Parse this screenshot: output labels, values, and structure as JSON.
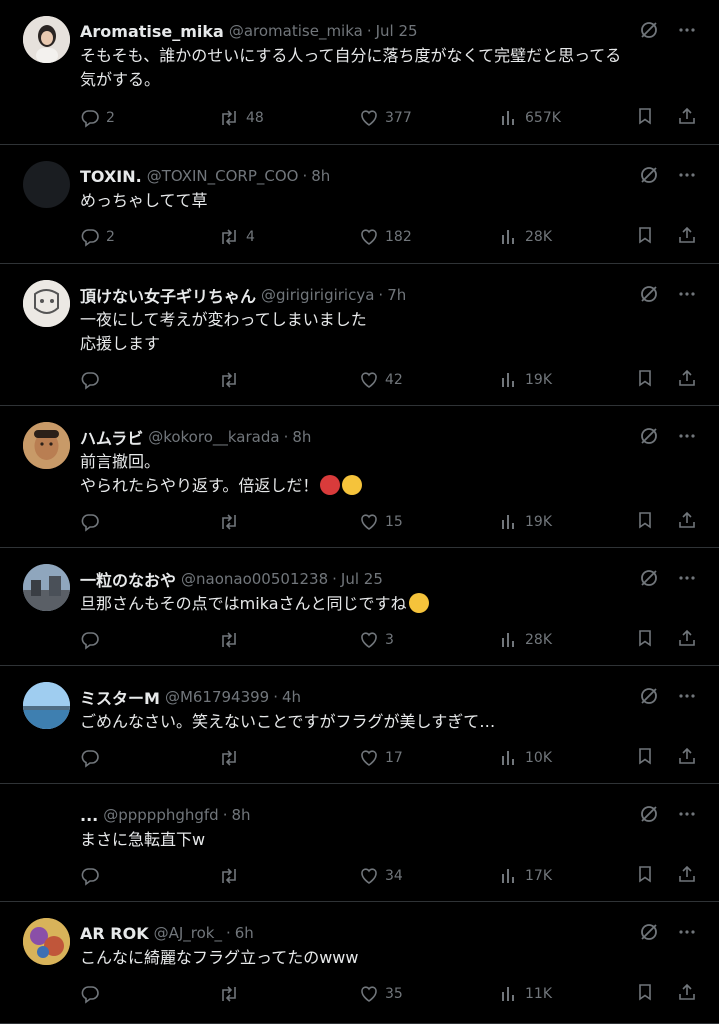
{
  "tweets": [
    {
      "name": "Aromatise_mika",
      "handle": "@aromatise_mika",
      "time": "Jul 25",
      "text": "そもそも、誰かのせいにする人って自分に落ち度がなくて完璧だと思ってる\n気がする。",
      "replies": "2",
      "retweets": "48",
      "likes": "377",
      "views": "657K"
    },
    {
      "name": "TOXIN.",
      "handle": "@TOXIN_CORP_COO",
      "time": "8h",
      "text": "めっちゃしてて草",
      "replies": "2",
      "retweets": "4",
      "likes": "182",
      "views": "28K"
    },
    {
      "name": "頂けない女子ギリちゃん",
      "handle": "@girigirigiricya",
      "time": "7h",
      "text": "一夜にして考えが変わってしまいました\n応援します",
      "replies": "",
      "retweets": "",
      "likes": "42",
      "views": "19K"
    },
    {
      "name": "ハムラビ",
      "handle": "@kokoro__karada",
      "time": "8h",
      "text": "前言撤回。",
      "text2": "やられたらやり返す。倍返しだ！",
      "replies": "",
      "retweets": "",
      "likes": "15",
      "views": "19K"
    },
    {
      "name": "一粒のなおや",
      "handle": "@naonao00501238",
      "time": "Jul 25",
      "text": "旦那さんもその点ではmikaさんと同じですね",
      "replies": "",
      "retweets": "",
      "likes": "3",
      "views": "28K"
    },
    {
      "name": "ミスターM",
      "handle": "@M61794399",
      "time": "4h",
      "text": "ごめんなさい。笑えないことですがフラグが美しすぎて…",
      "replies": "",
      "retweets": "",
      "likes": "17",
      "views": "10K"
    },
    {
      "name": "...",
      "handle": "@ppppphghgfd",
      "time": "8h",
      "text": "まさに急転直下w",
      "replies": "",
      "retweets": "",
      "likes": "34",
      "views": "17K"
    },
    {
      "name": "AR ROK",
      "handle": "@AJ_rok_",
      "time": "6h",
      "text": "こんなに綺麗なフラグ立ってたのwww",
      "replies": "",
      "retweets": "",
      "likes": "35",
      "views": "11K"
    }
  ],
  "separator": "·",
  "colors": {
    "background": "#000000",
    "text": "#e7e9ea",
    "muted": "#71767b",
    "border": "#2f3336"
  },
  "icons": [
    "grok-icon",
    "more-icon",
    "reply-icon",
    "retweet-icon",
    "like-icon",
    "views-icon",
    "bookmark-icon",
    "share-icon"
  ]
}
